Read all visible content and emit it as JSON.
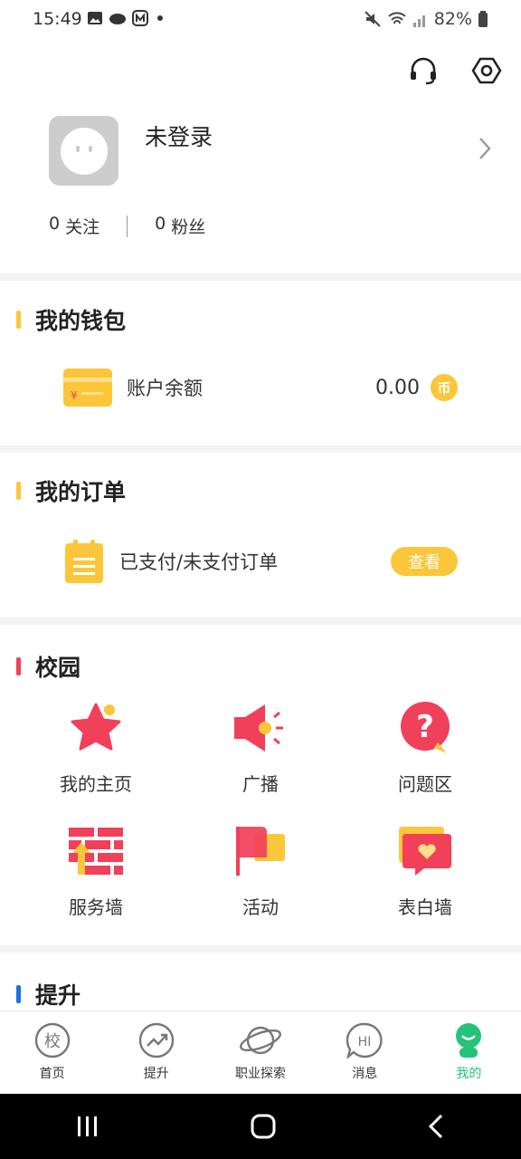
{
  "status_bar": {
    "time": "15:49",
    "battery": "82%"
  },
  "profile": {
    "username": "未登录",
    "following_count": "0",
    "following_label": "关注",
    "followers_count": "0",
    "followers_label": "粉丝"
  },
  "wallet": {
    "title": "我的钱包",
    "accent": "#fcc63a",
    "balance_label": "账户余额",
    "balance_value": "0.00",
    "coin_glyph": "币"
  },
  "orders": {
    "title": "我的订单",
    "accent": "#fcc63a",
    "label": "已支付/未支付订单",
    "view_button": "查看"
  },
  "campus": {
    "title": "校园",
    "accent": "#f0405a",
    "items": [
      {
        "label": "我的主页",
        "icon": "star-icon"
      },
      {
        "label": "广播",
        "icon": "megaphone-icon"
      },
      {
        "label": "问题区",
        "icon": "question-icon"
      },
      {
        "label": "服务墙",
        "icon": "brick-wall-icon"
      },
      {
        "label": "活动",
        "icon": "flag-icon"
      },
      {
        "label": "表白墙",
        "icon": "heart-message-icon"
      }
    ]
  },
  "improve": {
    "title": "提升",
    "accent": "#1e6fe8"
  },
  "tabbar": {
    "active_color": "#27c27a",
    "items": [
      {
        "label": "首页",
        "icon_text": "校"
      },
      {
        "label": "提升"
      },
      {
        "label": "职业探索"
      },
      {
        "label": "消息",
        "icon_text": "HI"
      },
      {
        "label": "我的"
      }
    ]
  }
}
